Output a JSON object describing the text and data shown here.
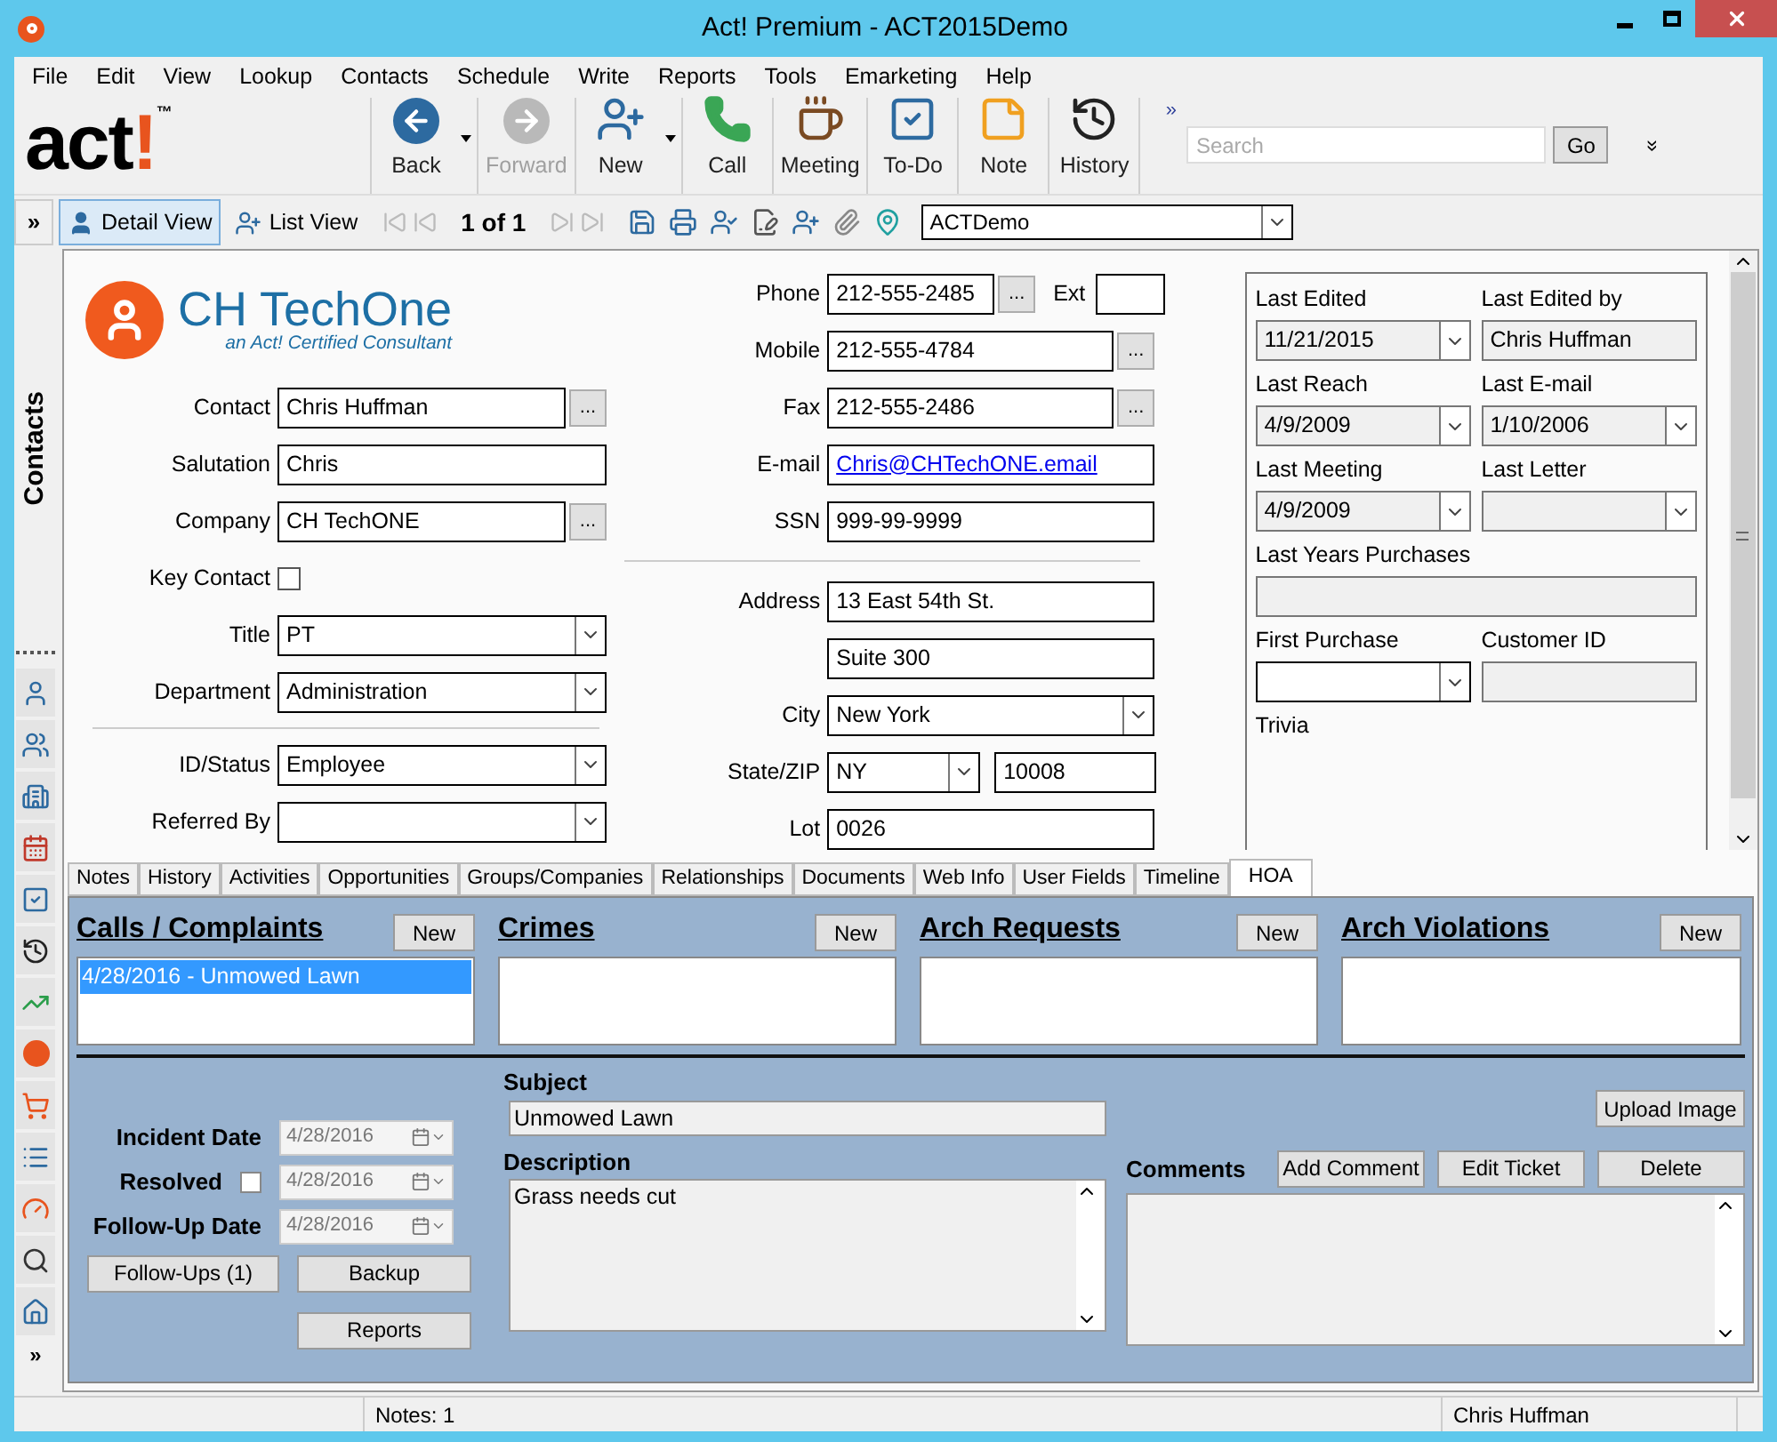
{
  "window": {
    "title": "Act! Premium - ACT2015Demo",
    "controls": [
      {
        "kind": "minimize"
      },
      {
        "kind": "maximize"
      },
      {
        "kind": "close"
      }
    ]
  },
  "menu": [
    "File",
    "Edit",
    "View",
    "Lookup",
    "Contacts",
    "Schedule",
    "Write",
    "Reports",
    "Tools",
    "Emarketing",
    "Help"
  ],
  "logo": {
    "word": "act",
    "bang": "!",
    "mark": "™"
  },
  "toolbar": [
    {
      "label": "Back",
      "kind": "back",
      "disabled": false,
      "dropdown": true
    },
    {
      "label": "Forward",
      "kind": "forward",
      "disabled": true,
      "dropdown": false
    },
    {
      "label": "New",
      "kind": "new",
      "disabled": false,
      "dropdown": true
    },
    {
      "label": "Call",
      "kind": "call",
      "disabled": false,
      "dropdown": false
    },
    {
      "label": "Meeting",
      "kind": "meeting",
      "disabled": false,
      "dropdown": false
    },
    {
      "label": "To-Do",
      "kind": "todo",
      "disabled": false,
      "dropdown": false
    },
    {
      "label": "Note",
      "kind": "note",
      "disabled": false,
      "dropdown": false
    },
    {
      "label": "History",
      "kind": "history",
      "disabled": false,
      "dropdown": false
    }
  ],
  "toolbar_more": "»",
  "search": {
    "placeholder": "Search",
    "button": "Go",
    "more": "»"
  },
  "view_bar": {
    "expand": "»",
    "views": [
      {
        "label": "Detail View",
        "kind": "detail",
        "selected": true
      },
      {
        "label": "List View",
        "kind": "list",
        "selected": false
      }
    ],
    "record": "1 of 1",
    "database": "ACTDemo"
  },
  "sidebar": {
    "title": "Contacts",
    "items": [
      {
        "kind": "contact"
      },
      {
        "kind": "group"
      },
      {
        "kind": "company"
      },
      {
        "kind": "calendar"
      },
      {
        "kind": "task"
      },
      {
        "kind": "history"
      },
      {
        "kind": "opportunity"
      },
      {
        "kind": "emarketing"
      },
      {
        "kind": "cart"
      },
      {
        "kind": "list"
      },
      {
        "kind": "dashboard"
      },
      {
        "kind": "search"
      },
      {
        "kind": "home"
      }
    ],
    "more": "»"
  },
  "company_logo": {
    "name": "CH TechOne",
    "tagline": "an Act! Certified Consultant"
  },
  "contact_fields": [
    {
      "label": "Contact",
      "value": "Chris Huffman",
      "kind": "lookup",
      "button": "..."
    },
    {
      "label": "Salutation",
      "value": "Chris",
      "kind": "text"
    },
    {
      "label": "Company",
      "value": "CH TechONE",
      "kind": "lookup",
      "button": "..."
    },
    {
      "label": "Key Contact",
      "kind": "checkbox",
      "checked": false
    },
    {
      "label": "Title",
      "value": "PT",
      "kind": "dropdown"
    },
    {
      "label": "Department",
      "value": "Administration",
      "kind": "dropdown"
    }
  ],
  "status_fields": [
    {
      "label": "ID/Status",
      "value": "Employee",
      "kind": "dropdown"
    },
    {
      "label": "Referred By",
      "kind": "dropdown"
    }
  ],
  "phone_fields": [
    {
      "label": "Phone",
      "value": "212-555-2485",
      "kind": "phone",
      "button": "...",
      "ext_label": "Ext"
    },
    {
      "label": "Mobile",
      "value": "212-555-4784",
      "kind": "lookup",
      "button": "..."
    },
    {
      "label": "Fax",
      "value": "212-555-2486",
      "kind": "lookup",
      "button": "..."
    },
    {
      "label": "E-mail",
      "value": "Chris@CHTechONE.email",
      "kind": "link"
    },
    {
      "label": "SSN",
      "value": "999-99-9999",
      "kind": "text"
    }
  ],
  "address_fields": [
    {
      "label": "Address",
      "value": "13 East 54th St.",
      "kind": "text"
    },
    {
      "value": "Suite 300",
      "kind": "text"
    },
    {
      "label": "City",
      "value": "New York",
      "kind": "dropdown"
    },
    {
      "label": "State/ZIP",
      "value": "NY",
      "zip": "10008",
      "kind": "state"
    },
    {
      "label": "Lot",
      "value": "0026",
      "kind": "text"
    }
  ],
  "record_panel": [
    [
      {
        "label": "Last Edited",
        "value": "11/21/2015",
        "kind": "date"
      },
      {
        "label": "Last Edited by",
        "value": "Chris Huffman",
        "kind": "readonly"
      }
    ],
    [
      {
        "label": "Last Reach",
        "value": "4/9/2009",
        "kind": "date"
      },
      {
        "label": "Last E-mail",
        "value": "1/10/2006",
        "kind": "date"
      }
    ],
    [
      {
        "label": "Last Meeting",
        "value": "4/9/2009",
        "kind": "date"
      },
      {
        "label": "Last Letter",
        "kind": "date"
      }
    ],
    [
      {
        "label": "Last Years Purchases",
        "kind": "wide"
      }
    ],
    [
      {
        "label": "First Purchase",
        "kind": "dropdown"
      },
      {
        "label": "Customer ID",
        "kind": "readonly"
      }
    ],
    [
      {
        "label": "Trivia",
        "kind": "label"
      }
    ]
  ],
  "tabs": [
    {
      "label": "Notes",
      "selected": false
    },
    {
      "label": "History",
      "selected": false
    },
    {
      "label": "Activities",
      "selected": false
    },
    {
      "label": "Opportunities",
      "selected": false
    },
    {
      "label": "Groups/Companies",
      "selected": false
    },
    {
      "label": "Relationships",
      "selected": false
    },
    {
      "label": "Documents",
      "selected": false
    },
    {
      "label": "Web Info",
      "selected": false
    },
    {
      "label": "User Fields",
      "selected": false
    },
    {
      "label": "Timeline",
      "selected": false
    },
    {
      "label": "HOA",
      "selected": true
    }
  ],
  "hoa_sections": [
    {
      "title": "Calls / Complaints",
      "button": "New",
      "items": [
        {
          "text": "4/28/2016 - Unmowed Lawn",
          "selected": true
        }
      ]
    },
    {
      "title": "Crimes",
      "button": "New"
    },
    {
      "title": "Arch Requests",
      "button": "New"
    },
    {
      "title": "Arch Violations",
      "button": "New"
    }
  ],
  "ticket": {
    "dates": [
      {
        "label": "Incident Date",
        "value": "4/28/2016",
        "disabled": true
      },
      {
        "label": "Resolved",
        "value": "4/28/2016",
        "checked": false,
        "disabled": true
      },
      {
        "label": "Follow-Up Date",
        "value": "4/28/2016",
        "disabled": true
      }
    ],
    "left_buttons": [
      "Follow-Ups (1)",
      "Backup",
      "Reports"
    ],
    "subject_label": "Subject",
    "subject": "Unmowed Lawn",
    "description_label": "Description",
    "description": "Grass needs cut",
    "comments_label": "Comments",
    "upload_button": "Upload Image",
    "action_buttons": [
      "Add Comment",
      "Edit Ticket",
      "Delete"
    ]
  },
  "status_bar": {
    "notes": "Notes: 1",
    "user": "Chris Huffman"
  }
}
